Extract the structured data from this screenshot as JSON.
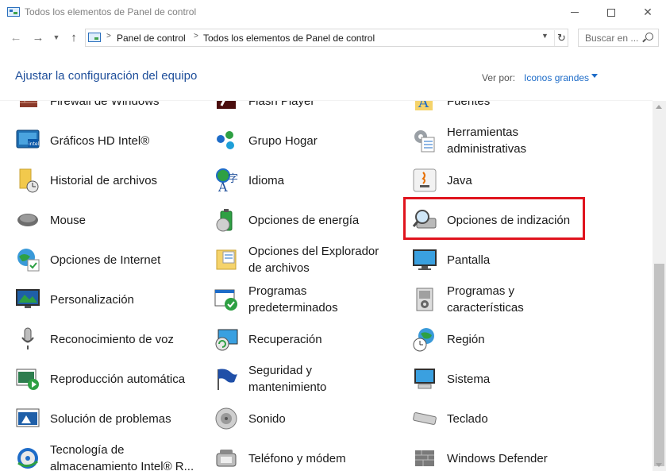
{
  "window": {
    "title": "Todos los elementos de Panel de control",
    "minimize": "—",
    "maximize": "☐",
    "close": "✕"
  },
  "nav": {
    "back": "←",
    "forward": "→",
    "recent": "⌄",
    "up": "↑"
  },
  "address": {
    "separator": ">",
    "crumbs": [
      "Panel de control",
      "Todos los elementos de Panel de control"
    ],
    "dropdown": "⌄",
    "refresh": "↻"
  },
  "search": {
    "placeholder": "Buscar en ..."
  },
  "header": {
    "title": "Ajustar la configuración del equipo",
    "view_by_label": "Ver por:",
    "view_by_value": "Iconos grandes"
  },
  "colors": {
    "highlight": "#e0141e",
    "link_blue": "#1e6cc8"
  },
  "items": [
    {
      "label": "Firewall de Windows",
      "icon": "firewall-icon"
    },
    {
      "label": "Flash Player",
      "icon": "flash-player-icon"
    },
    {
      "label": "Fuentes",
      "icon": "fonts-icon"
    },
    {
      "label": "Gráficos HD Intel®",
      "icon": "intel-graphics-icon"
    },
    {
      "label": "Grupo Hogar",
      "icon": "homegroup-icon"
    },
    {
      "label": "Herramientas administrativas",
      "icon": "admin-tools-icon"
    },
    {
      "label": "Historial de archivos",
      "icon": "file-history-icon"
    },
    {
      "label": "Idioma",
      "icon": "language-icon"
    },
    {
      "label": "Java",
      "icon": "java-icon"
    },
    {
      "label": "Mouse",
      "icon": "mouse-icon"
    },
    {
      "label": "Opciones de energía",
      "icon": "power-options-icon"
    },
    {
      "label": "Opciones de indización",
      "icon": "indexing-options-icon"
    },
    {
      "label": "Opciones de Internet",
      "icon": "internet-options-icon"
    },
    {
      "label": "Opciones del Explorador de archivos",
      "icon": "explorer-options-icon"
    },
    {
      "label": "Pantalla",
      "icon": "display-icon"
    },
    {
      "label": "Personalización",
      "icon": "personalization-icon"
    },
    {
      "label": "Programas predeterminados",
      "icon": "default-programs-icon"
    },
    {
      "label": "Programas y características",
      "icon": "programs-features-icon"
    },
    {
      "label": "Reconocimiento de voz",
      "icon": "speech-recognition-icon"
    },
    {
      "label": "Recuperación",
      "icon": "recovery-icon"
    },
    {
      "label": "Región",
      "icon": "region-icon"
    },
    {
      "label": "Reproducción automática",
      "icon": "autoplay-icon"
    },
    {
      "label": "Seguridad y mantenimiento",
      "icon": "security-maintenance-icon"
    },
    {
      "label": "Sistema",
      "icon": "system-icon"
    },
    {
      "label": "Solución de problemas",
      "icon": "troubleshooting-icon"
    },
    {
      "label": "Sonido",
      "icon": "sound-icon"
    },
    {
      "label": "Teclado",
      "icon": "keyboard-icon"
    },
    {
      "label": "Tecnología de almacenamiento Intel® R...",
      "icon": "intel-storage-icon"
    },
    {
      "label": "Teléfono y módem",
      "icon": "phone-modem-icon"
    },
    {
      "label": "Windows Defender",
      "icon": "windows-defender-icon"
    }
  ]
}
